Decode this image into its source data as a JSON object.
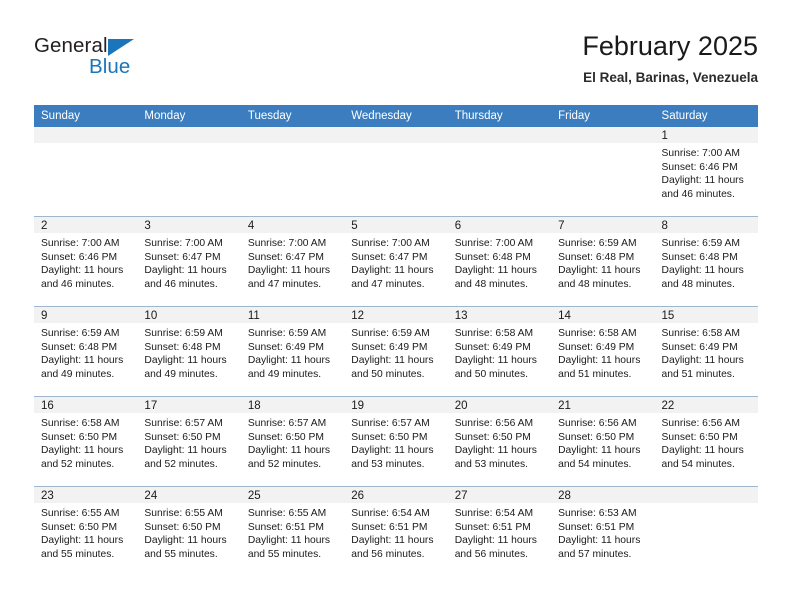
{
  "brand": {
    "name_top": "General",
    "name_bottom": "Blue",
    "accent_color": "#1b75bb",
    "triangle_icon": "triangle-icon"
  },
  "header": {
    "month_title": "February 2025",
    "location": "El Real, Barinas, Venezuela"
  },
  "theme": {
    "header_row_bg": "#3b7dbf",
    "daynum_band_bg": "#f2f2f2",
    "grid_line": "#9fb6cd"
  },
  "weekday_headers": [
    "Sunday",
    "Monday",
    "Tuesday",
    "Wednesday",
    "Thursday",
    "Friday",
    "Saturday"
  ],
  "labels": {
    "sunrise_prefix": "Sunrise:",
    "sunset_prefix": "Sunset:",
    "daylight_prefix": "Daylight:"
  },
  "weeks": [
    [
      {
        "day": "",
        "empty": true
      },
      {
        "day": "",
        "empty": true
      },
      {
        "day": "",
        "empty": true
      },
      {
        "day": "",
        "empty": true
      },
      {
        "day": "",
        "empty": true
      },
      {
        "day": "",
        "empty": true
      },
      {
        "day": "1",
        "sunrise": "Sunrise: 7:00 AM",
        "sunset": "Sunset: 6:46 PM",
        "daylight1": "Daylight: 11 hours",
        "daylight2": "and 46 minutes."
      }
    ],
    [
      {
        "day": "2",
        "sunrise": "Sunrise: 7:00 AM",
        "sunset": "Sunset: 6:46 PM",
        "daylight1": "Daylight: 11 hours",
        "daylight2": "and 46 minutes."
      },
      {
        "day": "3",
        "sunrise": "Sunrise: 7:00 AM",
        "sunset": "Sunset: 6:47 PM",
        "daylight1": "Daylight: 11 hours",
        "daylight2": "and 46 minutes."
      },
      {
        "day": "4",
        "sunrise": "Sunrise: 7:00 AM",
        "sunset": "Sunset: 6:47 PM",
        "daylight1": "Daylight: 11 hours",
        "daylight2": "and 47 minutes."
      },
      {
        "day": "5",
        "sunrise": "Sunrise: 7:00 AM",
        "sunset": "Sunset: 6:47 PM",
        "daylight1": "Daylight: 11 hours",
        "daylight2": "and 47 minutes."
      },
      {
        "day": "6",
        "sunrise": "Sunrise: 7:00 AM",
        "sunset": "Sunset: 6:48 PM",
        "daylight1": "Daylight: 11 hours",
        "daylight2": "and 48 minutes."
      },
      {
        "day": "7",
        "sunrise": "Sunrise: 6:59 AM",
        "sunset": "Sunset: 6:48 PM",
        "daylight1": "Daylight: 11 hours",
        "daylight2": "and 48 minutes."
      },
      {
        "day": "8",
        "sunrise": "Sunrise: 6:59 AM",
        "sunset": "Sunset: 6:48 PM",
        "daylight1": "Daylight: 11 hours",
        "daylight2": "and 48 minutes."
      }
    ],
    [
      {
        "day": "9",
        "sunrise": "Sunrise: 6:59 AM",
        "sunset": "Sunset: 6:48 PM",
        "daylight1": "Daylight: 11 hours",
        "daylight2": "and 49 minutes."
      },
      {
        "day": "10",
        "sunrise": "Sunrise: 6:59 AM",
        "sunset": "Sunset: 6:48 PM",
        "daylight1": "Daylight: 11 hours",
        "daylight2": "and 49 minutes."
      },
      {
        "day": "11",
        "sunrise": "Sunrise: 6:59 AM",
        "sunset": "Sunset: 6:49 PM",
        "daylight1": "Daylight: 11 hours",
        "daylight2": "and 49 minutes."
      },
      {
        "day": "12",
        "sunrise": "Sunrise: 6:59 AM",
        "sunset": "Sunset: 6:49 PM",
        "daylight1": "Daylight: 11 hours",
        "daylight2": "and 50 minutes."
      },
      {
        "day": "13",
        "sunrise": "Sunrise: 6:58 AM",
        "sunset": "Sunset: 6:49 PM",
        "daylight1": "Daylight: 11 hours",
        "daylight2": "and 50 minutes."
      },
      {
        "day": "14",
        "sunrise": "Sunrise: 6:58 AM",
        "sunset": "Sunset: 6:49 PM",
        "daylight1": "Daylight: 11 hours",
        "daylight2": "and 51 minutes."
      },
      {
        "day": "15",
        "sunrise": "Sunrise: 6:58 AM",
        "sunset": "Sunset: 6:49 PM",
        "daylight1": "Daylight: 11 hours",
        "daylight2": "and 51 minutes."
      }
    ],
    [
      {
        "day": "16",
        "sunrise": "Sunrise: 6:58 AM",
        "sunset": "Sunset: 6:50 PM",
        "daylight1": "Daylight: 11 hours",
        "daylight2": "and 52 minutes."
      },
      {
        "day": "17",
        "sunrise": "Sunrise: 6:57 AM",
        "sunset": "Sunset: 6:50 PM",
        "daylight1": "Daylight: 11 hours",
        "daylight2": "and 52 minutes."
      },
      {
        "day": "18",
        "sunrise": "Sunrise: 6:57 AM",
        "sunset": "Sunset: 6:50 PM",
        "daylight1": "Daylight: 11 hours",
        "daylight2": "and 52 minutes."
      },
      {
        "day": "19",
        "sunrise": "Sunrise: 6:57 AM",
        "sunset": "Sunset: 6:50 PM",
        "daylight1": "Daylight: 11 hours",
        "daylight2": "and 53 minutes."
      },
      {
        "day": "20",
        "sunrise": "Sunrise: 6:56 AM",
        "sunset": "Sunset: 6:50 PM",
        "daylight1": "Daylight: 11 hours",
        "daylight2": "and 53 minutes."
      },
      {
        "day": "21",
        "sunrise": "Sunrise: 6:56 AM",
        "sunset": "Sunset: 6:50 PM",
        "daylight1": "Daylight: 11 hours",
        "daylight2": "and 54 minutes."
      },
      {
        "day": "22",
        "sunrise": "Sunrise: 6:56 AM",
        "sunset": "Sunset: 6:50 PM",
        "daylight1": "Daylight: 11 hours",
        "daylight2": "and 54 minutes."
      }
    ],
    [
      {
        "day": "23",
        "sunrise": "Sunrise: 6:55 AM",
        "sunset": "Sunset: 6:50 PM",
        "daylight1": "Daylight: 11 hours",
        "daylight2": "and 55 minutes."
      },
      {
        "day": "24",
        "sunrise": "Sunrise: 6:55 AM",
        "sunset": "Sunset: 6:50 PM",
        "daylight1": "Daylight: 11 hours",
        "daylight2": "and 55 minutes."
      },
      {
        "day": "25",
        "sunrise": "Sunrise: 6:55 AM",
        "sunset": "Sunset: 6:51 PM",
        "daylight1": "Daylight: 11 hours",
        "daylight2": "and 55 minutes."
      },
      {
        "day": "26",
        "sunrise": "Sunrise: 6:54 AM",
        "sunset": "Sunset: 6:51 PM",
        "daylight1": "Daylight: 11 hours",
        "daylight2": "and 56 minutes."
      },
      {
        "day": "27",
        "sunrise": "Sunrise: 6:54 AM",
        "sunset": "Sunset: 6:51 PM",
        "daylight1": "Daylight: 11 hours",
        "daylight2": "and 56 minutes."
      },
      {
        "day": "28",
        "sunrise": "Sunrise: 6:53 AM",
        "sunset": "Sunset: 6:51 PM",
        "daylight1": "Daylight: 11 hours",
        "daylight2": "and 57 minutes."
      },
      {
        "day": "",
        "empty": true
      }
    ]
  ]
}
